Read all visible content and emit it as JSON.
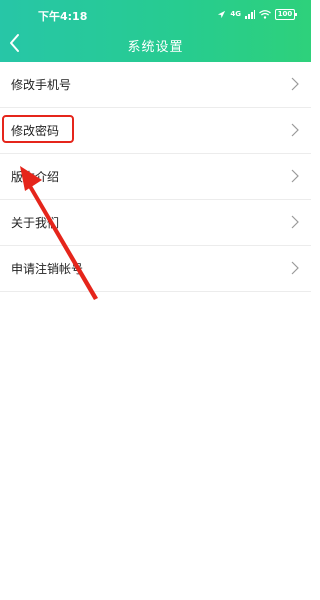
{
  "status_bar": {
    "time": "下午4:18",
    "signal": "4G",
    "battery": "100"
  },
  "header": {
    "title": "系统设置"
  },
  "menu": {
    "items": [
      {
        "label": "修改手机号"
      },
      {
        "label": "修改密码"
      },
      {
        "label": "版本介绍"
      },
      {
        "label": "关于我们"
      },
      {
        "label": "申请注销帐号"
      }
    ]
  },
  "colors": {
    "header_gradient_start": "#27c6a7",
    "header_gradient_end": "#2ed17b",
    "annotation_red": "#e5251b"
  }
}
